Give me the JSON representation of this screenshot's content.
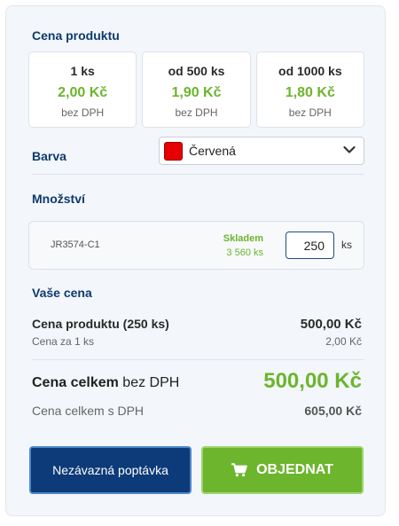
{
  "product_price": {
    "title": "Cena produktu",
    "tiers": [
      {
        "qty": "1 ks",
        "price": "2,00 Kč",
        "note": "bez DPH"
      },
      {
        "qty": "od 500 ks",
        "price": "1,90 Kč",
        "note": "bez DPH"
      },
      {
        "qty": "od 1000 ks",
        "price": "1,80 Kč",
        "note": "bez DPH"
      }
    ]
  },
  "color": {
    "label": "Barva",
    "selected": "Červená",
    "swatch_color": "#e60000"
  },
  "quantity": {
    "label": "Množství",
    "sku": "JR3574-C1",
    "stock_label": "Skladem",
    "stock_count": "3 560 ks",
    "value": "250",
    "unit": "ks"
  },
  "your_price": {
    "title": "Vaše cena",
    "product_line_label": "Cena produktu (250 ks)",
    "product_line_value": "500,00 Kč",
    "unit_label": "Cena za 1 ks",
    "unit_value": "2,00 Kč",
    "total_label_bold": "Cena celkem",
    "total_label_rest": " bez DPH",
    "total_value": "500,00 Kč",
    "total_vat_label": "Cena celkem s DPH",
    "total_vat_value": "605,00 Kč"
  },
  "buttons": {
    "inquiry": "Nezávazná poptávka",
    "order": "OBJEDNAT",
    "order_icon": "cart-icon"
  },
  "colors": {
    "accent_green": "#6cb52d",
    "brand_navy": "#0d3a78",
    "heading_blue": "#0e3a6e"
  }
}
